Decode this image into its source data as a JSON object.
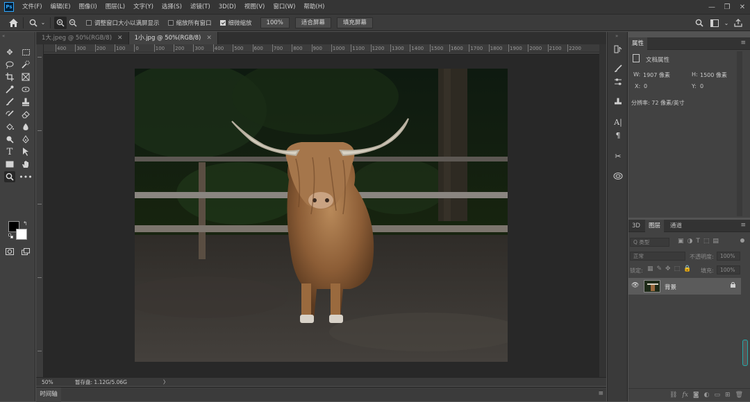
{
  "app": {
    "logo": "Ps"
  },
  "menu": [
    "文件(F)",
    "编辑(E)",
    "图像(I)",
    "图层(L)",
    "文字(Y)",
    "选择(S)",
    "滤镜(T)",
    "3D(D)",
    "视图(V)",
    "窗口(W)",
    "帮助(H)"
  ],
  "window_controls": {
    "minimize": "—",
    "restore": "❐",
    "close": "✕"
  },
  "options": {
    "resize_windows_label": "调整窗口大小以满屏显示",
    "zoom_all_label": "缩放所有窗口",
    "scrubby_zoom_label": "细微缩放",
    "zoom_value": "100%",
    "fit_screen": "适合屏幕",
    "fill_screen": "填充屏幕"
  },
  "tabs": [
    {
      "label": "1大.jpeg @ 50%(RGB/8)",
      "close": "✕"
    },
    {
      "label": "1小.jpg @ 50%(RGB/8)",
      "close": "✕"
    }
  ],
  "ruler": {
    "top": [
      "400",
      "300",
      "200",
      "100",
      "0",
      "100",
      "200",
      "300",
      "400",
      "500",
      "600",
      "700",
      "800",
      "900",
      "1000",
      "1100",
      "1200",
      "1300",
      "1400",
      "1500",
      "1600",
      "1700",
      "1800",
      "1900",
      "2000",
      "2100",
      "2200"
    ]
  },
  "status": {
    "zoom": "50%",
    "scratch": "暂存盘: 1.12G/5.06G",
    "arrow": "〉"
  },
  "timeline": {
    "label": "时间轴"
  },
  "properties": {
    "tab": "属性",
    "doc_label": "文档属性",
    "w_label": "W:",
    "w_value": "1907 像素",
    "h_label": "H:",
    "h_value": "1500 像素",
    "x_label": "X:",
    "x_value": "0",
    "y_label": "Y:",
    "y_value": "0",
    "resolution": "分辨率: 72 像素/英寸"
  },
  "layers": {
    "tabs": [
      "3D",
      "图层",
      "通道"
    ],
    "filter_placeholder": "Q 类型",
    "blend_mode": "正常",
    "opacity_label": "不透明度:",
    "opacity_value": "100%",
    "lock_label": "锁定:",
    "fill_label": "填充:",
    "fill_value": "100%",
    "layer_name": "背景"
  },
  "colors": {
    "accent": "#31a8ff",
    "foreground": "#000000",
    "background": "#ffffff"
  }
}
